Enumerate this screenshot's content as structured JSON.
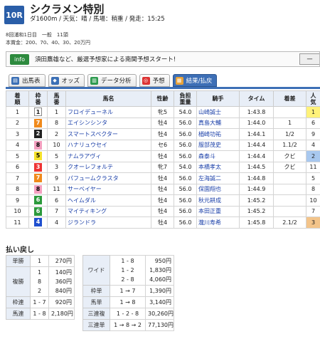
{
  "race": {
    "number": "10R",
    "title": "シクラメン特別",
    "conditions": "ダ1600m / 天気：晴 / 馬場：稍重 / 発走：15:25",
    "meeting": "8回浦和1日目　一般　11頭",
    "prize": "本賞金：200、70、40、30、20万円"
  },
  "banner": {
    "tag": "info",
    "text": "須田鷹雄など、厳選予想家による南関予想スタート!",
    "button": "一"
  },
  "tabs": [
    {
      "label": "出馬表",
      "icon": "list-icon",
      "color": "#3b6fb5"
    },
    {
      "label": "オッズ",
      "icon": "odds-icon",
      "color": "#3b6fb5"
    },
    {
      "label": "データ分析",
      "icon": "chart-icon",
      "color": "#2e9b4f"
    },
    {
      "label": "予想",
      "icon": "target-icon",
      "color": "#d33"
    },
    {
      "label": "結果/払戻",
      "icon": "result-icon",
      "color": "#e7a23a",
      "active": true
    }
  ],
  "results_headers": [
    "着順",
    "枠番",
    "馬番",
    "馬名",
    "性齢",
    "負担重量",
    "騎手",
    "タイム",
    "着差",
    "人気"
  ],
  "results": [
    {
      "pos": "1",
      "waku": "1",
      "no": "1",
      "name": "フロイデューネル",
      "sex_age": "牝5",
      "weight": "54.0",
      "jockey": "山崎誠士",
      "time": "1:43.8",
      "margin": "",
      "pop": "1"
    },
    {
      "pos": "2",
      "waku": "7",
      "no": "8",
      "name": "エイシンシンタ",
      "sex_age": "牡4",
      "weight": "56.0",
      "jockey": "真島大輔",
      "time": "1:44.0",
      "margin": "1",
      "pop": "6"
    },
    {
      "pos": "3",
      "waku": "2",
      "no": "2",
      "name": "スマートスペクター",
      "sex_age": "牡4",
      "weight": "56.0",
      "jockey": "楢崎功祐",
      "time": "1:44.1",
      "margin": "1/2",
      "pop": "9"
    },
    {
      "pos": "4",
      "waku": "8",
      "no": "10",
      "name": "ハナリュウセイ",
      "sex_age": "セ6",
      "weight": "56.0",
      "jockey": "服部茂史",
      "time": "1:44.4",
      "margin": "1.1/2",
      "pop": "4"
    },
    {
      "pos": "5",
      "waku": "5",
      "no": "5",
      "name": "ナムラアヴィ",
      "sex_age": "牡4",
      "weight": "56.0",
      "jockey": "森泰斗",
      "time": "1:44.4",
      "margin": "クビ",
      "pop": "2"
    },
    {
      "pos": "6",
      "waku": "3",
      "no": "3",
      "name": "クオーレフォルテ",
      "sex_age": "牝7",
      "weight": "54.0",
      "jockey": "本橋孝太",
      "time": "1:44.5",
      "margin": "クビ",
      "pop": "11"
    },
    {
      "pos": "7",
      "waku": "7",
      "no": "9",
      "name": "パフュームクラスタ",
      "sex_age": "牡4",
      "weight": "56.0",
      "jockey": "左海誠二",
      "time": "1:44.8",
      "margin": "",
      "pop": "5"
    },
    {
      "pos": "8",
      "waku": "8",
      "no": "11",
      "name": "サーベイヤー",
      "sex_age": "牡4",
      "weight": "56.0",
      "jockey": "保園翔也",
      "time": "1:44.9",
      "margin": "",
      "pop": "8"
    },
    {
      "pos": "9",
      "waku": "6",
      "no": "6",
      "name": "ヘイムダル",
      "sex_age": "牡4",
      "weight": "56.0",
      "jockey": "秋元耕成",
      "time": "1:45.2",
      "margin": "",
      "pop": "10"
    },
    {
      "pos": "10",
      "waku": "6",
      "no": "7",
      "name": "マイティキング",
      "sex_age": "牡4",
      "weight": "56.0",
      "jockey": "本田正重",
      "time": "1:45.2",
      "margin": "",
      "pop": "7"
    },
    {
      "pos": "11",
      "waku": "4",
      "no": "4",
      "name": "ジランドラ",
      "sex_age": "牡4",
      "weight": "56.0",
      "jockey": "瀧川寿希",
      "time": "1:45.8",
      "margin": "2.1/2",
      "pop": "3"
    }
  ],
  "payouts": {
    "title": "払い戻し",
    "left": [
      {
        "type": "単勝",
        "combos": [
          "1"
        ],
        "amounts": [
          "270円"
        ]
      },
      {
        "type": "複勝",
        "combos": [
          "1",
          "8",
          "2"
        ],
        "amounts": [
          "140円",
          "360円",
          "840円"
        ]
      },
      {
        "type": "枠連",
        "combos": [
          "1 - 7"
        ],
        "amounts": [
          "920円"
        ]
      },
      {
        "type": "馬連",
        "combos": [
          "1 - 8"
        ],
        "amounts": [
          "2,180円"
        ]
      }
    ],
    "right": [
      {
        "type": "ワイド",
        "combos": [
          "1 - 8",
          "1 - 2",
          "2 - 8"
        ],
        "amounts": [
          "950円",
          "1,830円",
          "4,060円"
        ]
      },
      {
        "type": "枠単",
        "combos": [
          "1 → 7"
        ],
        "amounts": [
          "1,390円"
        ]
      },
      {
        "type": "馬単",
        "combos": [
          "1 → 8"
        ],
        "amounts": [
          "3,140円"
        ]
      },
      {
        "type": "三連複",
        "combos": [
          "1 - 2 - 8"
        ],
        "amounts": [
          "30,260円"
        ]
      },
      {
        "type": "三連単",
        "combos": [
          "1 → 8 → 2"
        ],
        "amounts": [
          "77,130円"
        ]
      }
    ]
  }
}
